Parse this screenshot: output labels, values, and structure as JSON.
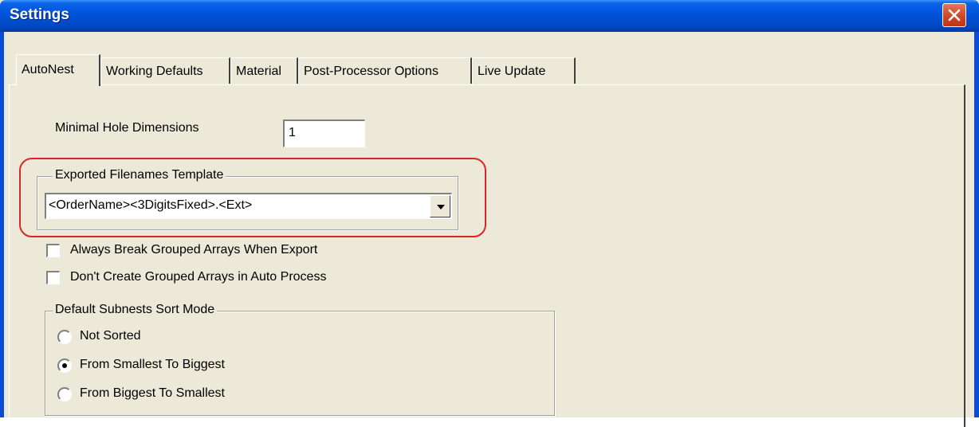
{
  "window": {
    "title": "Settings"
  },
  "tabs": [
    {
      "label": "AutoNest",
      "active": true
    },
    {
      "label": "Working Defaults",
      "active": false
    },
    {
      "label": "Material",
      "active": false
    },
    {
      "label": "Post-Processor Options",
      "active": false
    },
    {
      "label": "Live Update",
      "active": false
    }
  ],
  "autonest": {
    "min_hole_label": "Minimal Hole Dimensions",
    "min_hole_value": "1",
    "exported_group_title": "Exported Filenames Template",
    "exported_template_value": "<OrderName><3DigitsFixed>.<Ext>",
    "checkboxes": [
      {
        "label": "Always Break Grouped Arrays When Export",
        "checked": false
      },
      {
        "label": "Don't Create Grouped Arrays in Auto Process",
        "checked": false
      }
    ],
    "sort_group_title": "Default Subnests Sort Mode",
    "sort_options": [
      {
        "label": "Not Sorted",
        "selected": false
      },
      {
        "label": "From Smallest To Biggest",
        "selected": true
      },
      {
        "label": "From Biggest To Smallest",
        "selected": false
      }
    ]
  },
  "colors": {
    "titlebar": "#0052d9",
    "dialog_bg": "#ece9d8",
    "highlight": "#d9262a"
  }
}
